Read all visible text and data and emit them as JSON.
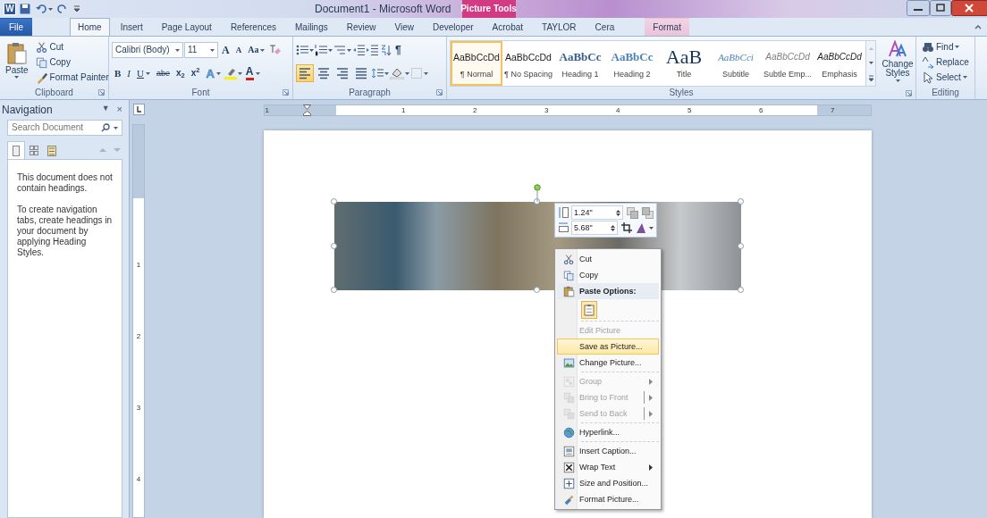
{
  "title_bar": {
    "logo_letter": "W",
    "title": "Document1 - Microsoft Word",
    "contextual_group": "Picture Tools"
  },
  "ribbon_tabs": [
    {
      "label": "File",
      "kind": "file",
      "selected": false
    },
    {
      "label": "Home",
      "kind": "normal",
      "selected": true
    },
    {
      "label": "Insert",
      "kind": "normal",
      "selected": false
    },
    {
      "label": "Page Layout",
      "kind": "normal",
      "selected": false
    },
    {
      "label": "References",
      "kind": "normal",
      "selected": false
    },
    {
      "label": "Mailings",
      "kind": "normal",
      "selected": false
    },
    {
      "label": "Review",
      "kind": "normal",
      "selected": false
    },
    {
      "label": "View",
      "kind": "normal",
      "selected": false
    },
    {
      "label": "Developer",
      "kind": "normal",
      "selected": false
    },
    {
      "label": "Acrobat",
      "kind": "normal",
      "selected": false
    },
    {
      "label": "TAYLOR",
      "kind": "normal",
      "selected": false
    },
    {
      "label": "Cera",
      "kind": "normal",
      "selected": false
    },
    {
      "label": "Format",
      "kind": "contextual",
      "selected": false
    }
  ],
  "clipboard": {
    "label": "Clipboard",
    "paste": "Paste",
    "commands": [
      "Cut",
      "Copy",
      "Format Painter"
    ]
  },
  "font": {
    "label": "Font",
    "name": "Calibri (Body)",
    "size": "11",
    "row1": [
      {
        "label": "A",
        "kind": "grow"
      },
      {
        "label": "A",
        "kind": "shrink"
      },
      {
        "label": "Aa",
        "kind": "case"
      }
    ],
    "row2": [
      {
        "label": "B",
        "kind": "bold"
      },
      {
        "label": "I",
        "kind": "italic"
      },
      {
        "label": "U",
        "kind": "underline"
      },
      {
        "label": "abe",
        "kind": "strike"
      },
      {
        "label": "x$_{2}$",
        "kind": "subscript"
      },
      {
        "label": "x$^{2}$",
        "kind": "superscript"
      },
      {
        "label": "A",
        "kind": "effects"
      },
      {
        "label": "A",
        "kind": "font_color"
      }
    ]
  },
  "paragraph": {
    "label": "Paragraph",
    "pilcrow": "¶",
    "alignments": [
      {
        "selected": true
      },
      {
        "selected": false
      },
      {
        "selected": false
      },
      {
        "selected": false
      }
    ]
  },
  "styles": {
    "label": "Styles",
    "change_styles": "Change Styles",
    "gallery": [
      {
        "sample": "AaBbCcDd",
        "name": "¶ Normal",
        "kind": "body",
        "selected": true
      },
      {
        "sample": "AaBbCcDd",
        "name": "¶ No Spacing",
        "kind": "body",
        "selected": false
      },
      {
        "sample": "AaBbCc",
        "name": "Heading 1",
        "kind": "heading1",
        "selected": false
      },
      {
        "sample": "AaBbCc",
        "name": "Heading 2",
        "kind": "heading2",
        "selected": false
      },
      {
        "sample": "AaB",
        "name": "Title",
        "kind": "title",
        "selected": false
      },
      {
        "sample": "AaBbCci",
        "name": "Subtitle",
        "kind": "subtitle",
        "selected": false
      },
      {
        "sample": "AaBbCcDd",
        "name": "Subtle Emp...",
        "kind": "subtle",
        "selected": false
      },
      {
        "sample": "AaBbCcDd",
        "name": "Emphasis",
        "kind": "emphasis",
        "selected": false
      }
    ]
  },
  "editing": {
    "label": "Editing",
    "commands": [
      "Find",
      "Replace",
      "Select"
    ]
  },
  "navigation": {
    "title": "Navigation",
    "menu_glyph": "▼",
    "close_glyph": "×",
    "search_placeholder": "Search Document",
    "tabs": [
      {
        "selected": true
      },
      {
        "selected": false
      },
      {
        "selected": false
      }
    ],
    "messages": [
      "This document does not contain headings.",
      "To create navigation tabs, create headings in your document by applying Heading Styles."
    ]
  },
  "horizontal_ruler": [
    "1",
    "1",
    "2",
    "3",
    "4",
    "5",
    "6",
    "7"
  ],
  "vertical_ruler": [
    "1",
    "2",
    "3",
    "4"
  ],
  "mini_toolbar": {
    "height": "1.24\"",
    "width": "5.68\""
  },
  "context_menu": [
    {
      "label": "Cut",
      "kind": "item",
      "disabled": false,
      "selected": false
    },
    {
      "label": "Copy",
      "kind": "item",
      "disabled": false,
      "selected": false
    },
    {
      "label": "Paste Options:",
      "kind": "header"
    },
    {
      "kind": "paste_options"
    },
    {
      "label": "Edit Picture",
      "kind": "item",
      "disabled": true,
      "selected": false
    },
    {
      "label": "Save as Picture...",
      "kind": "item",
      "disabled": false,
      "selected": true
    },
    {
      "label": "Change Picture...",
      "kind": "item",
      "disabled": false,
      "selected": false
    },
    {
      "label": "Group",
      "kind": "item",
      "disabled": true,
      "selected": false,
      "has_submenu": true
    },
    {
      "label": "Bring to Front",
      "kind": "item",
      "disabled": true,
      "selected": false,
      "has_submenu": true,
      "split": true
    },
    {
      "label": "Send to Back",
      "kind": "item",
      "disabled": true,
      "selected": false,
      "has_submenu": true,
      "split": true
    },
    {
      "label": "Hyperlink...",
      "kind": "item",
      "disabled": false,
      "selected": false
    },
    {
      "label": "Insert Caption...",
      "kind": "item",
      "disabled": false,
      "selected": false
    },
    {
      "label": "Wrap Text",
      "kind": "item",
      "disabled": false,
      "selected": false,
      "has_submenu": true
    },
    {
      "label": "Size and Position...",
      "kind": "item",
      "disabled": false,
      "selected": false
    },
    {
      "label": "Format Picture...",
      "kind": "item",
      "disabled": false,
      "selected": false
    }
  ]
}
